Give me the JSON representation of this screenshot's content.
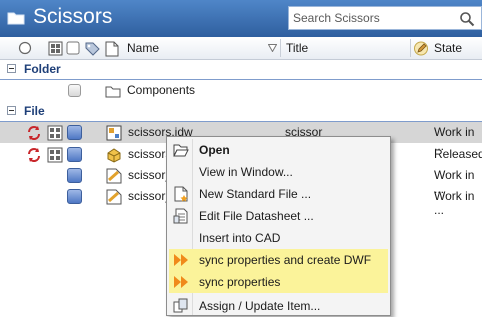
{
  "window": {
    "title": "Scissors"
  },
  "search": {
    "placeholder": "Search Scissors"
  },
  "columns": {
    "name": "Name",
    "title": "Title",
    "state": "State"
  },
  "groups": {
    "folder": "Folder",
    "file": "File"
  },
  "folder_rows": [
    {
      "name": "Components"
    }
  ],
  "file_rows": [
    {
      "name": "scissors.idw",
      "title": "scissor",
      "state": "Work in ..."
    },
    {
      "name": "scissors",
      "title": "",
      "state": "Released"
    },
    {
      "name": "scissor_",
      "title": "",
      "state": "Work in ..."
    },
    {
      "name": "scissor_",
      "title": "",
      "state": "Work in ..."
    }
  ],
  "context_menu": {
    "items": [
      {
        "label": "Open",
        "icon": "open-folder-icon"
      },
      {
        "label": "View in Window...",
        "icon": ""
      },
      {
        "label": "New Standard File ...",
        "icon": "new-file-icon"
      },
      {
        "label": "Edit File Datasheet ...",
        "icon": "datasheet-icon"
      },
      {
        "label": "Insert into CAD",
        "icon": ""
      },
      {
        "label": "sync properties and create DWF",
        "icon": "run-arrows-icon",
        "highlight": "#fbf39a"
      },
      {
        "label": "sync properties",
        "icon": "run-arrows-icon",
        "highlight": "#fbf39a"
      },
      {
        "label": "Assign / Update Item...",
        "icon": "assign-icon"
      }
    ]
  },
  "colors": {
    "title_bar": "#3a6eb3",
    "highlight": "#fbf39a",
    "selected_row": "#d6d6d6"
  }
}
